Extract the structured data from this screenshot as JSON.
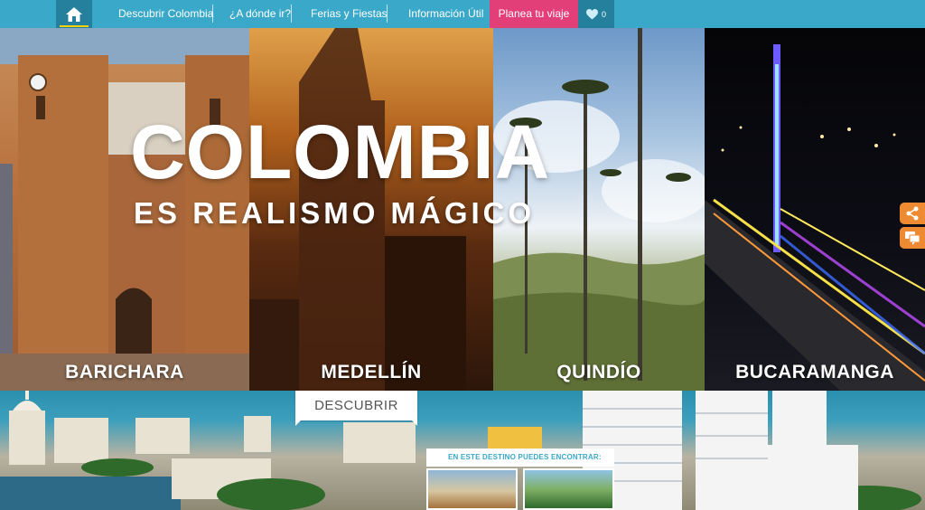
{
  "nav": {
    "home_icon": "home-icon",
    "items": [
      "Descubrir Colombia",
      "¿A dónde ir?",
      "Ferias y Fiestas",
      "Información Útil"
    ],
    "plan_label": "Planea tu viaje",
    "favorites_icon": "heart-icon",
    "favorites_count": "0"
  },
  "hero": {
    "title": "COLOMBIA",
    "subtitle": "ES REALISMO MÁGICO",
    "cities": [
      "BARICHARA",
      "MEDELLÍN",
      "QUINDÍO",
      "BUCARAMANGA"
    ]
  },
  "side_actions": [
    "share-icon",
    "chat-icon"
  ],
  "discover": {
    "tab_label": "DESCUBRIR",
    "destination_heading": "EN ESTE DESTINO PUEDES ENCONTRAR:"
  },
  "colors": {
    "nav_bg": "#3aa8c8",
    "nav_dark": "#24809c",
    "plan_pink": "#e23f79",
    "side_orange": "#ee8a32"
  }
}
